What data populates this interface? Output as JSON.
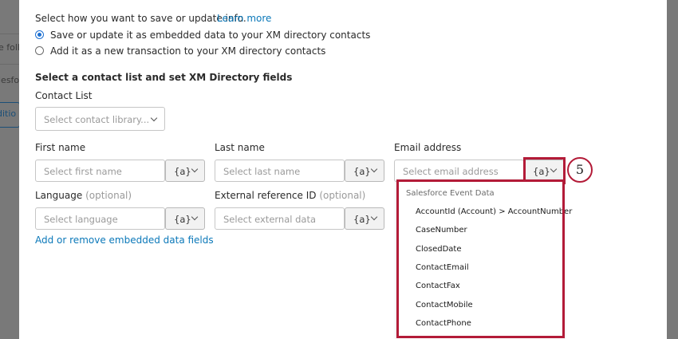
{
  "background": {
    "items": [
      "e follo",
      "lesforc",
      "ditio"
    ]
  },
  "intro": {
    "prompt": "Select how you want to save or update info.",
    "learn_more": "Learn more"
  },
  "save_options": [
    {
      "label": "Save or update it as embedded data to your XM directory contacts",
      "selected": true
    },
    {
      "label": "Add it as a new transaction to your XM directory contacts",
      "selected": false
    }
  ],
  "section_title": "Select a contact list and set XM Directory fields",
  "contact_list": {
    "label": "Contact List",
    "placeholder": "Select contact library..."
  },
  "fields": {
    "first_name": {
      "label": "First name",
      "placeholder": "Select first name"
    },
    "last_name": {
      "label": "Last name",
      "placeholder": "Select last name"
    },
    "email": {
      "label": "Email address",
      "placeholder": "Select email address"
    },
    "language": {
      "label": "Language",
      "optional": "(optional)",
      "placeholder": "Select language"
    },
    "external_id": {
      "label": "External reference ID",
      "optional": "(optional)",
      "placeholder": "Select external data"
    }
  },
  "piped_text_label": "{a}",
  "add_remove_link": "Add or remove embedded data fields",
  "dropdown": {
    "header": "Salesforce Event Data",
    "items": [
      "AccountId (Account) > AccountNumber",
      "CaseNumber",
      "ClosedDate",
      "ContactEmail",
      "ContactFax",
      "ContactMobile",
      "ContactPhone"
    ]
  },
  "step_number": "5",
  "colors": {
    "highlight": "#b31b38",
    "link": "#0b78b9",
    "radio_selected": "#1c6fd1"
  }
}
